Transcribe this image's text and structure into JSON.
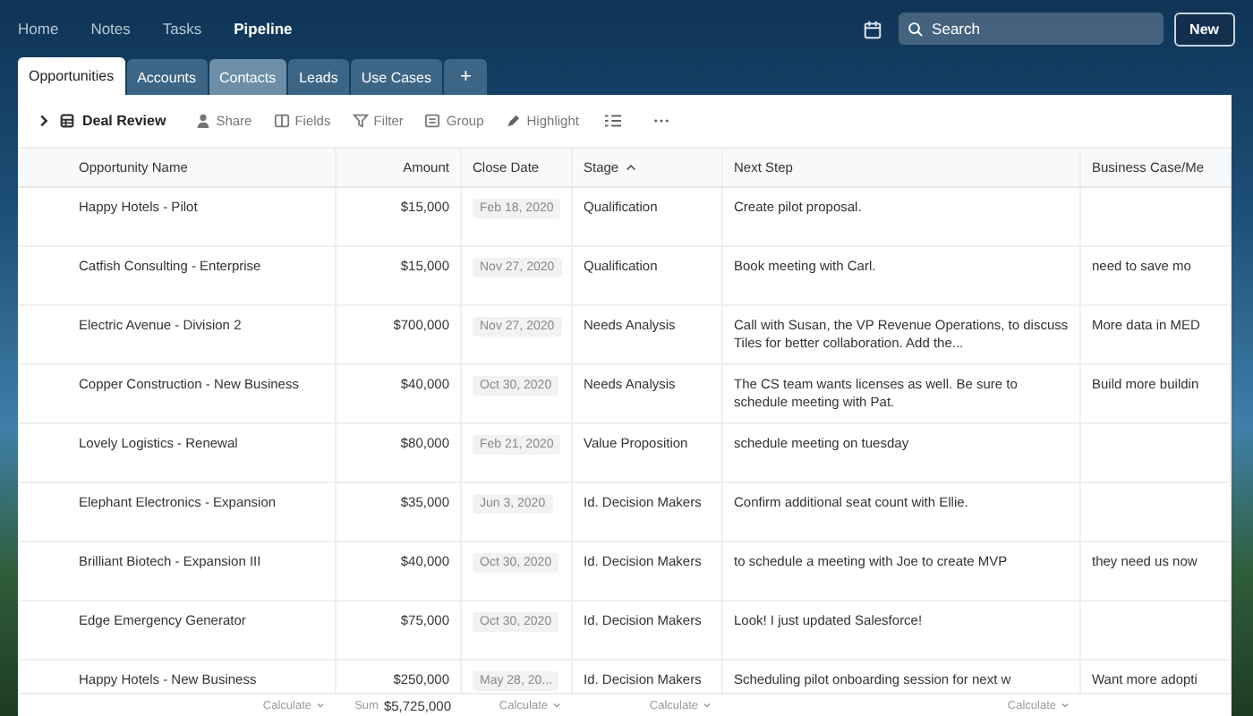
{
  "nav": {
    "links": [
      {
        "label": "Home",
        "selected": false
      },
      {
        "label": "Notes",
        "selected": false
      },
      {
        "label": "Tasks",
        "selected": false
      },
      {
        "label": "Pipeline",
        "selected": true
      }
    ],
    "search": {
      "placeholder": "Search"
    },
    "new_button": "New"
  },
  "tabs": [
    {
      "label": "Opportunities",
      "selected": true,
      "hovered": false
    },
    {
      "label": "Accounts",
      "selected": false,
      "hovered": false
    },
    {
      "label": "Contacts",
      "selected": false,
      "hovered": true
    },
    {
      "label": "Leads",
      "selected": false,
      "hovered": false
    },
    {
      "label": "Use Cases",
      "selected": false,
      "hovered": false
    }
  ],
  "add_tab": "+",
  "toolbar": {
    "view": "Deal Review",
    "actions": [
      {
        "kind": "share",
        "label": "Share"
      },
      {
        "kind": "fields",
        "label": "Fields"
      },
      {
        "kind": "filter",
        "label": "Filter"
      },
      {
        "kind": "group",
        "label": "Group"
      },
      {
        "kind": "highlight",
        "label": "Highlight"
      },
      {
        "kind": "row-height"
      },
      {
        "kind": "more"
      }
    ]
  },
  "table": {
    "columns": [
      {
        "label": "Opportunity Name",
        "sorted": false
      },
      {
        "label": "Amount",
        "sorted": false
      },
      {
        "label": "Close Date",
        "sorted": false
      },
      {
        "label": "Stage",
        "sorted": true
      },
      {
        "label": "Next Step",
        "sorted": false
      },
      {
        "label": "Business Case/Me",
        "sorted": false
      }
    ],
    "rows": [
      {
        "name": "Happy Hotels - Pilot",
        "amount": "$15,000",
        "close_date": "Feb 18, 2020",
        "stage": "Qualification",
        "next_step": "Create pilot proposal."
      },
      {
        "name": "Catfish Consulting - Enterprise",
        "amount": "$15,000",
        "close_date": "Nov 27, 2020",
        "stage": "Qualification",
        "next_step": "Book meeting with Carl.",
        "business_case": "need to save mo"
      },
      {
        "name": "Electric Avenue - Division 2",
        "amount": "$700,000",
        "close_date": "Nov 27, 2020",
        "stage": "Needs Analysis",
        "next_step": "Call with Susan, the VP Revenue Operations, to discuss Tiles for better collaboration. Add the...",
        "business_case": "More data in MED"
      },
      {
        "name": "Copper Construction - New Business",
        "amount": "$40,000",
        "close_date": "Oct 30, 2020",
        "stage": "Needs Analysis",
        "next_step": "The CS team wants licenses as well. Be sure to schedule meeting with Pat.",
        "business_case": "Build more buildin"
      },
      {
        "name": "Lovely Logistics - Renewal",
        "amount": "$80,000",
        "close_date": "Feb 21, 2020",
        "stage": "Value Proposition",
        "next_step": "schedule meeting on tuesday"
      },
      {
        "name": "Elephant Electronics - Expansion",
        "amount": "$35,000",
        "close_date": "Jun 3, 2020",
        "stage": "Id. Decision Makers",
        "next_step": "Confirm additional seat count with Ellie."
      },
      {
        "name": "Brilliant Biotech - Expansion III",
        "amount": "$40,000",
        "close_date": "Oct 30, 2020",
        "stage": "Id. Decision Makers",
        "next_step": "to schedule a meeting with Joe to create MVP",
        "business_case": "they need us now"
      },
      {
        "name": "Edge Emergency Generator",
        "amount": "$75,000",
        "close_date": "Oct 30, 2020",
        "stage": "Id. Decision Makers",
        "next_step": "Look! I just updated Salesforce!"
      },
      {
        "name": "Happy Hotels - New Business",
        "amount": "$250,000",
        "close_date": "May 28, 20...",
        "stage": "Id. Decision Makers",
        "next_step": "Scheduling pilot onboarding session for next w",
        "business_case": "Want more adopti"
      }
    ],
    "footer": [
      {
        "kind": "calculate",
        "label": "Calculate"
      },
      {
        "kind": "sum",
        "label": "Sum",
        "value": "$5,725,000"
      },
      {
        "kind": "calculate",
        "label": "Calculate"
      },
      {
        "kind": "calculate",
        "label": "Calculate"
      },
      {
        "kind": "calculate",
        "label": "Calculate"
      }
    ]
  }
}
